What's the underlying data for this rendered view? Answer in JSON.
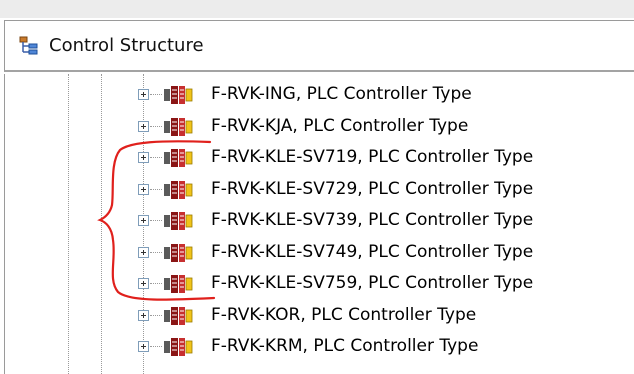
{
  "header": {
    "title": "Control Structure",
    "icon": "tree-structure-icon"
  },
  "tree": {
    "items": [
      {
        "label": "F-RVK-ING, PLC Controller Type"
      },
      {
        "label": "F-RVK-KJA, PLC Controller Type"
      },
      {
        "label": "F-RVK-KLE-SV719, PLC Controller Type"
      },
      {
        "label": "F-RVK-KLE-SV729, PLC Controller Type"
      },
      {
        "label": "F-RVK-KLE-SV739, PLC Controller Type"
      },
      {
        "label": "F-RVK-KLE-SV749, PLC Controller Type"
      },
      {
        "label": "F-RVK-KLE-SV759, PLC Controller Type"
      },
      {
        "label": "F-RVK-KOR, PLC Controller Type"
      },
      {
        "label": "F-RVK-KRM, PLC Controller Type"
      }
    ],
    "item_icon": "plc-controller-icon"
  },
  "annotation": {
    "color": "#e0201c",
    "shape": "red-brace"
  }
}
